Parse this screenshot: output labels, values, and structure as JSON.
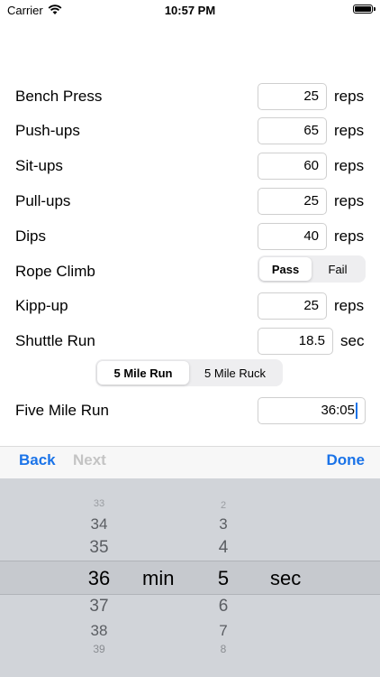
{
  "status": {
    "carrier": "Carrier",
    "time": "10:57 PM"
  },
  "form": {
    "bench_press": {
      "label": "Bench Press",
      "value": "25",
      "unit": "reps"
    },
    "push_ups": {
      "label": "Push-ups",
      "value": "65",
      "unit": "reps"
    },
    "sit_ups": {
      "label": "Sit-ups",
      "value": "60",
      "unit": "reps"
    },
    "pull_ups": {
      "label": "Pull-ups",
      "value": "25",
      "unit": "reps"
    },
    "dips": {
      "label": "Dips",
      "value": "40",
      "unit": "reps"
    },
    "rope_climb": {
      "label": "Rope Climb",
      "options": [
        "Pass",
        "Fail"
      ],
      "selected": "Pass"
    },
    "kipp_up": {
      "label": "Kipp-up",
      "value": "25",
      "unit": "reps"
    },
    "shuttle_run": {
      "label": "Shuttle Run",
      "value": "18.5",
      "unit": "sec"
    },
    "run_type": {
      "options": [
        "5 Mile Run",
        "5 Mile Ruck"
      ],
      "selected": "5 Mile Run"
    },
    "five_mile_run": {
      "label": "Five Mile Run",
      "value": "36:05"
    }
  },
  "toolbar": {
    "back": "Back",
    "next": "Next",
    "done": "Done"
  },
  "picker": {
    "minutes": [
      "33",
      "34",
      "35",
      "36",
      "37",
      "38",
      "39"
    ],
    "seconds": [
      "2",
      "3",
      "4",
      "5",
      "6",
      "7",
      "8"
    ],
    "selected_minutes": "36",
    "selected_seconds": "5",
    "min_label": "min",
    "sec_label": "sec"
  }
}
